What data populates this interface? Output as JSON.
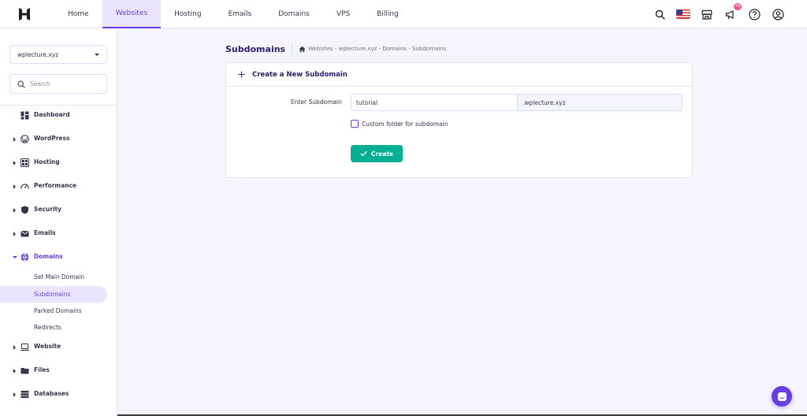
{
  "nav": {
    "items": [
      {
        "label": "Home"
      },
      {
        "label": "Websites"
      },
      {
        "label": "Hosting"
      },
      {
        "label": "Emails"
      },
      {
        "label": "Domains"
      },
      {
        "label": "VPS"
      },
      {
        "label": "Billing"
      }
    ],
    "active": "Websites",
    "notification_count": "29"
  },
  "sidebar": {
    "site_select": "wplecture.xyz",
    "search_placeholder": "Search",
    "items": [
      {
        "label": "Dashboard",
        "icon": "dashboard-icon"
      },
      {
        "label": "WordPress",
        "icon": "wordpress-icon"
      },
      {
        "label": "Hosting",
        "icon": "hosting-icon"
      },
      {
        "label": "Performance",
        "icon": "performance-icon"
      },
      {
        "label": "Security",
        "icon": "shield-icon"
      },
      {
        "label": "Emails",
        "icon": "mail-icon"
      },
      {
        "label": "Domains",
        "icon": "globe-icon"
      },
      {
        "label": "Website",
        "icon": "laptop-icon"
      },
      {
        "label": "Files",
        "icon": "folder-icon"
      },
      {
        "label": "Databases",
        "icon": "database-icon"
      }
    ],
    "domains_sub": [
      {
        "label": "Set Main Domain"
      },
      {
        "label": "Subdomains"
      },
      {
        "label": "Parked Domains"
      },
      {
        "label": "Redirects"
      }
    ]
  },
  "header": {
    "title": "Subdomains",
    "breadcrumb": "Websites - wplecture.xyz - Domains - Subdomains"
  },
  "form": {
    "card_title": "Create a New Subdomain",
    "field_label": "Enter Subdomain",
    "subdomain_value": "tutorial",
    "domain_suffix": ".wplecture.xyz",
    "custom_folder_label": "Custom folder for subdomain",
    "create_label": "Create"
  },
  "colors": {
    "primary": "#673de6",
    "success": "#00b090",
    "active_bg": "#ebe4ff",
    "badge": "#fc5185"
  }
}
